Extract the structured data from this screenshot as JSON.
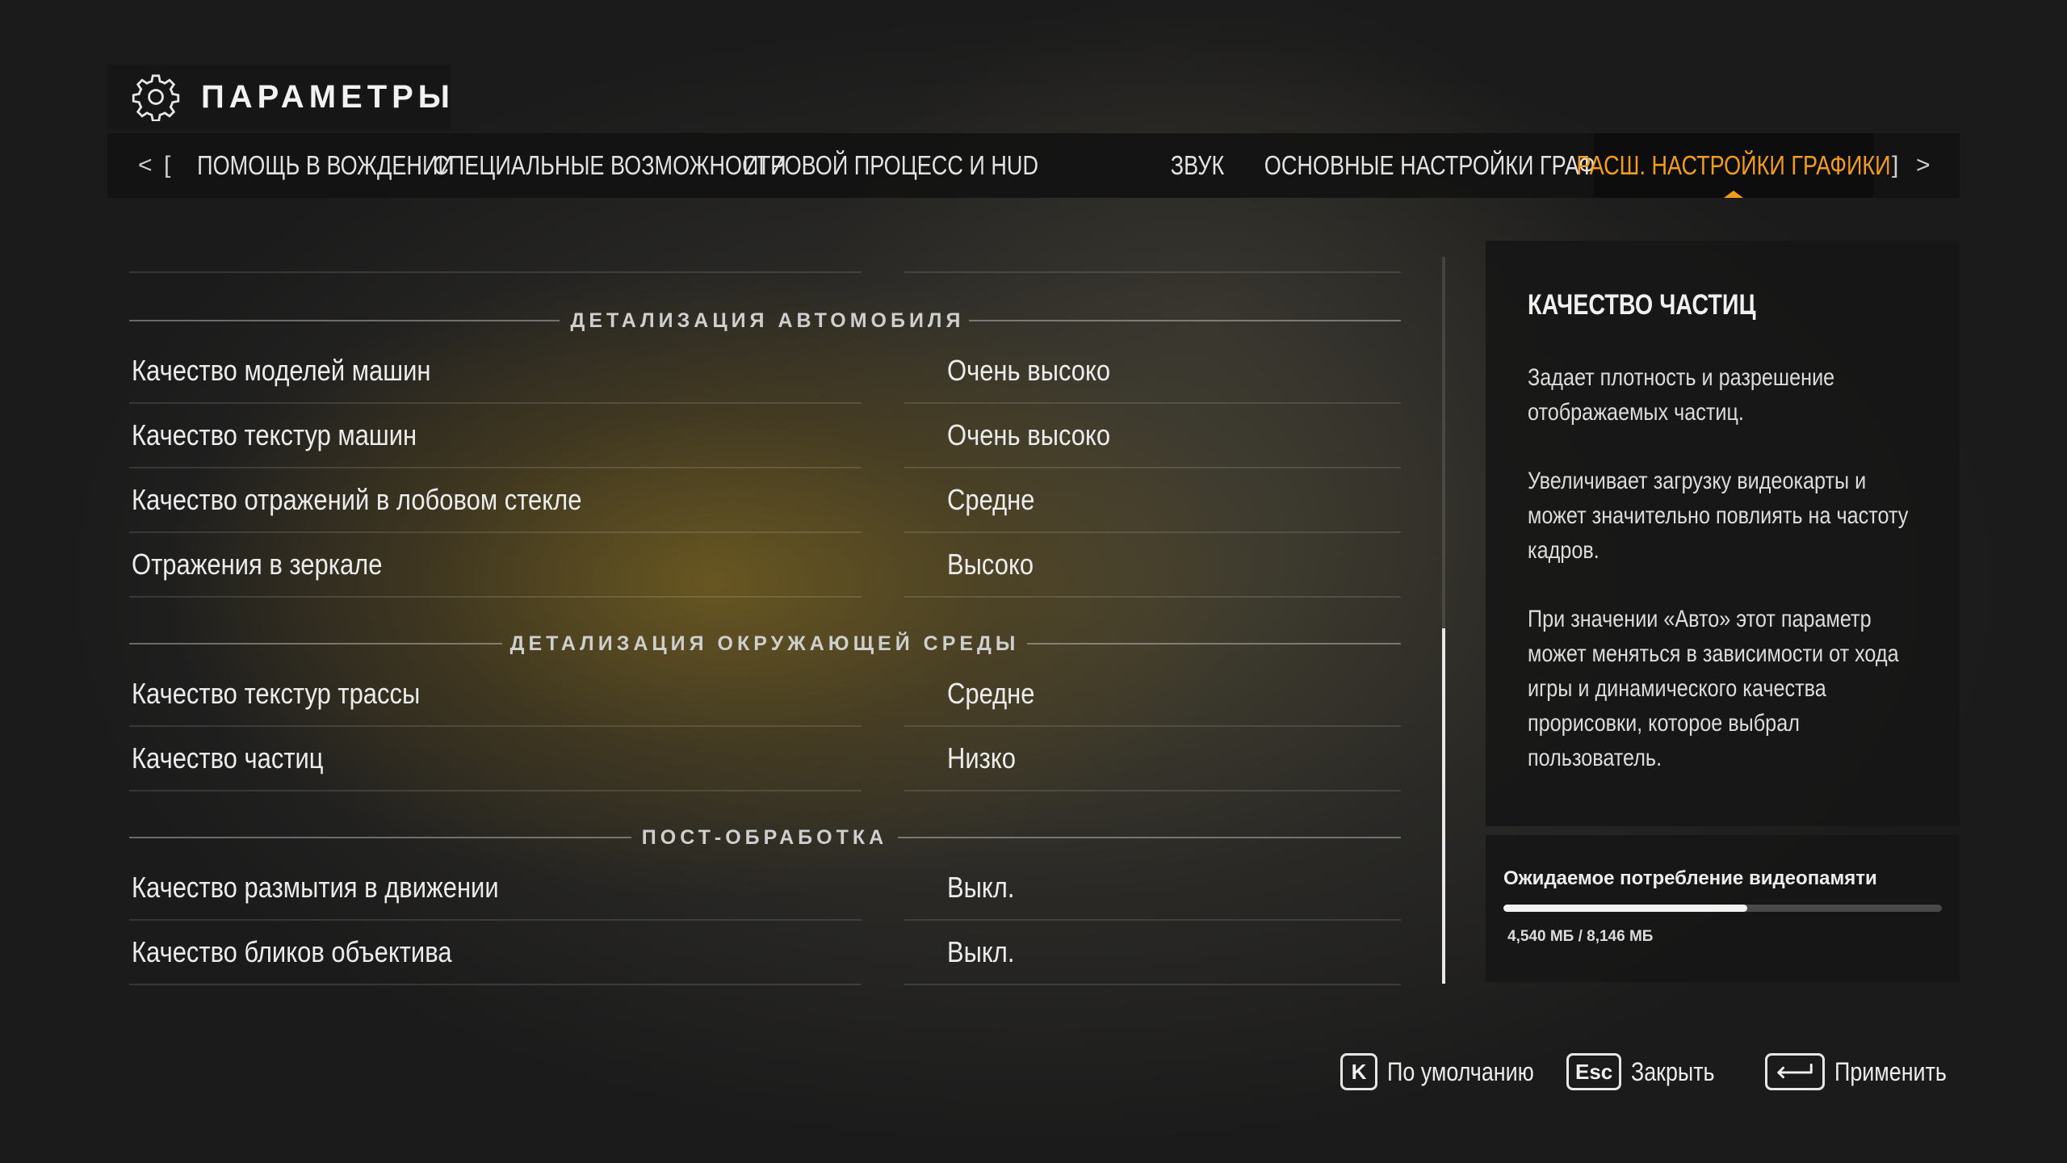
{
  "header": {
    "title": "ПАРАМЕТРЫ",
    "icon": "gear-icon"
  },
  "tabbar": {
    "prev_arrow": "<",
    "prev_bracket": "[",
    "next_bracket": "]",
    "next_arrow": ">",
    "tabs": [
      {
        "label": "ПОМОЩЬ В ВОЖДЕНИИ",
        "active": false
      },
      {
        "label": "СПЕЦИАЛЬНЫЕ ВОЗМОЖНОСТИ",
        "active": false
      },
      {
        "label": "ИГРОВОЙ ПРОЦЕСС И HUD",
        "active": false
      },
      {
        "label": "ЗВУК",
        "active": false
      },
      {
        "label": "ОСНОВНЫЕ НАСТРОЙКИ ГРАФИКИ",
        "active": false
      },
      {
        "label": "РАСШ. НАСТРОЙКИ ГРАФИКИ",
        "active": true
      }
    ],
    "accent_color": "#f39b1c"
  },
  "settings": {
    "sections": [
      {
        "title": "ДЕТАЛИЗАЦИЯ АВТОМОБИЛЯ",
        "rows": [
          {
            "label": "Качество моделей машин",
            "value": "Очень высоко"
          },
          {
            "label": "Качество текстур машин",
            "value": "Очень высоко"
          },
          {
            "label": "Качество отражений в лобовом стекле",
            "value": "Средне"
          },
          {
            "label": "Отражения в зеркале",
            "value": "Высоко"
          }
        ]
      },
      {
        "title": "ДЕТАЛИЗАЦИЯ ОКРУЖАЮЩЕЙ СРЕДЫ",
        "rows": [
          {
            "label": "Качество текстур трассы",
            "value": "Средне"
          },
          {
            "label": "Качество частиц",
            "value": "Низко"
          }
        ]
      },
      {
        "title": "ПОСТ-ОБРАБОТКА",
        "rows": [
          {
            "label": "Качество размытия в движении",
            "value": "Выкл."
          },
          {
            "label": "Качество бликов объектива",
            "value": "Выкл."
          }
        ]
      }
    ]
  },
  "description": {
    "title": "КАЧЕСТВО ЧАСТИЦ",
    "paragraphs": [
      "Задает плотность и разрешение отображаемых частиц.",
      "Увеличивает загрузку видеокарты и может значительно повлиять на частоту кадров.",
      "При значении «Авто» этот параметр может меняться в зависимости от хода игры и динамического качества прорисовки, которое выбрал пользователь."
    ]
  },
  "vram": {
    "title": "Ожидаемое потребление видеопамяти",
    "text": "4,540 МБ / 8,146 МБ",
    "used_fraction": 0.557
  },
  "footer": {
    "default": {
      "key": "K",
      "label": "По умолчанию"
    },
    "close": {
      "key": "Esc",
      "label": "Закрыть"
    },
    "apply": {
      "key": "enter-key-icon",
      "label": "Применить"
    }
  }
}
